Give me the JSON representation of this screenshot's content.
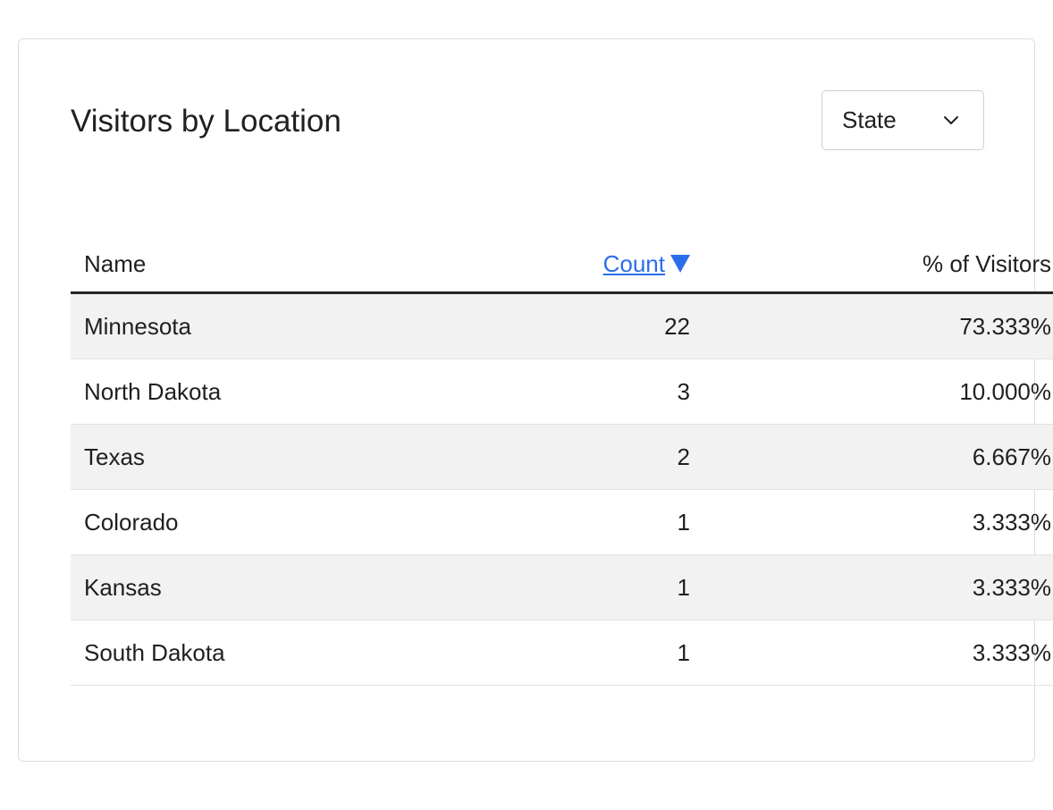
{
  "card": {
    "title": "Visitors by Location",
    "group_select": {
      "value": "State",
      "icon": "chevron-down-icon"
    }
  },
  "table": {
    "columns": {
      "name": "Name",
      "count": "Count",
      "percent": "% of Visitors"
    },
    "sort": {
      "column": "count",
      "direction": "descending",
      "icon": "sort-desc-icon"
    },
    "rows": [
      {
        "name": "Minnesota",
        "count": "22",
        "percent": "73.333%"
      },
      {
        "name": "North Dakota",
        "count": "3",
        "percent": "10.000%"
      },
      {
        "name": "Texas",
        "count": "2",
        "percent": "6.667%"
      },
      {
        "name": "Colorado",
        "count": "1",
        "percent": "3.333%"
      },
      {
        "name": "Kansas",
        "count": "1",
        "percent": "3.333%"
      },
      {
        "name": "South Dakota",
        "count": "1",
        "percent": "3.333%"
      }
    ]
  },
  "colors": {
    "link": "#2b6de8",
    "text": "#1f1f1f",
    "row_stripe": "#f2f2f2",
    "header_rule": "#262626",
    "card_border": "#dcdcdc"
  }
}
